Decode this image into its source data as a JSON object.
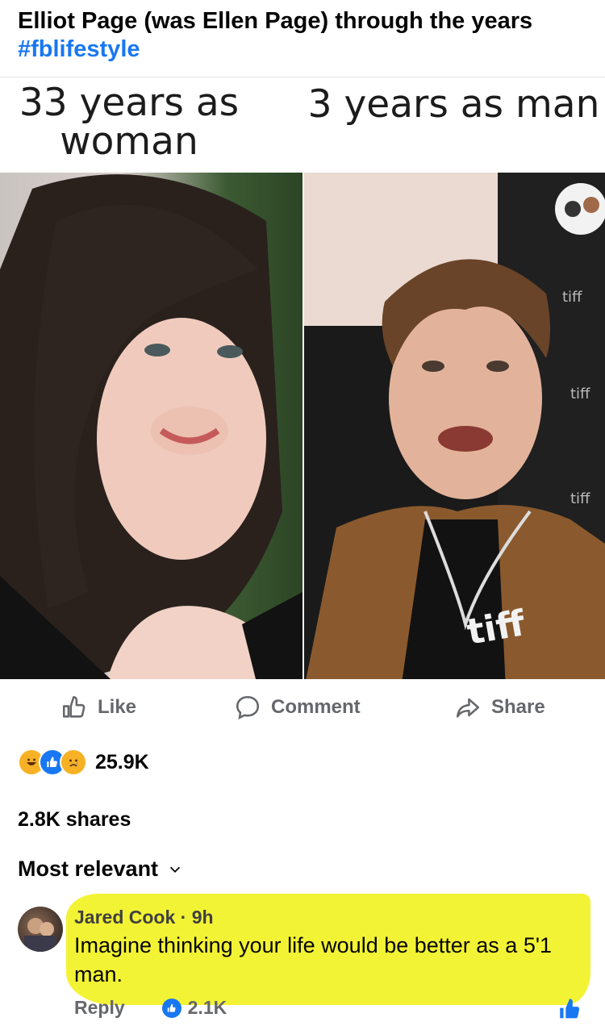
{
  "post": {
    "title": "Elliot Page (was Ellen Page) through the years",
    "hashtag": "#fblifestyle"
  },
  "meme": {
    "left_caption": "33 years as woman",
    "right_caption": "3 years as man",
    "shirt_logo": "tiff",
    "backdrop_logo": "tiff"
  },
  "actions": {
    "like_label": "Like",
    "comment_label": "Comment",
    "share_label": "Share"
  },
  "engagement": {
    "reaction_icons": [
      "haha-reaction-icon",
      "like-reaction-icon",
      "sad-reaction-icon"
    ],
    "reaction_count": "25.9K",
    "shares_text": "2.8K shares"
  },
  "comments": {
    "sort_label": "Most relevant",
    "items": [
      {
        "author": "Jared Cook",
        "time": "· 9h",
        "text": "Imagine thinking your life would be better as a 5'1 man.",
        "reply_label": "Reply",
        "like_count": "2.1K"
      }
    ]
  },
  "colors": {
    "accent": "#1877f2",
    "secondary_text": "#65676b",
    "highlight": "#f2f22a"
  }
}
